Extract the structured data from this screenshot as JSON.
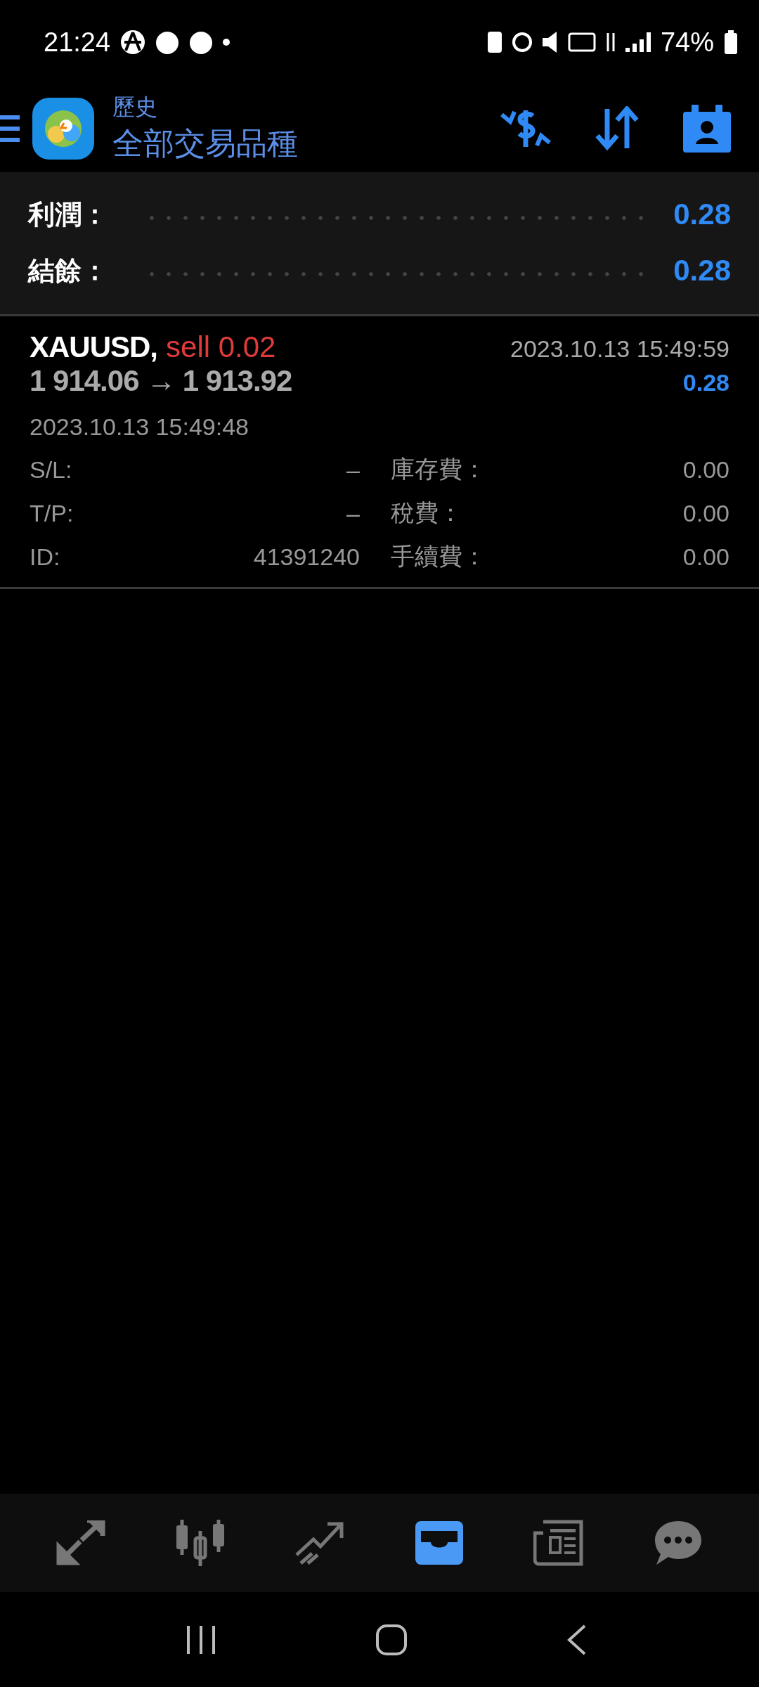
{
  "status_bar": {
    "time": "21:24",
    "battery": "74%"
  },
  "header": {
    "subtitle": "歷史",
    "title": "全部交易品種"
  },
  "summary": [
    {
      "label": "利潤：",
      "value": "0.28"
    },
    {
      "label": "結餘：",
      "value": "0.28"
    }
  ],
  "trade": {
    "symbol": "XAUUSD,",
    "side": "sell 0.02",
    "prices": "1 914.06 → 1 913.92",
    "close_time": "2023.10.13 15:49:59",
    "profit": "0.28",
    "open_time": "2023.10.13 15:49:48",
    "details": [
      {
        "label": "S/L:",
        "value": "–",
        "fee_label": "庫存費：",
        "fee_value": "0.00"
      },
      {
        "label": "T/P:",
        "value": "–",
        "fee_label": "稅費：",
        "fee_value": "0.00"
      },
      {
        "label": "ID:",
        "value": "41391240",
        "fee_label": "手續費：",
        "fee_value": "0.00"
      }
    ]
  },
  "bottom_nav": [
    {
      "kind": "quotes",
      "selected": false
    },
    {
      "kind": "chart",
      "selected": false
    },
    {
      "kind": "trade",
      "selected": false
    },
    {
      "kind": "history",
      "selected": true
    },
    {
      "kind": "news",
      "selected": false
    },
    {
      "kind": "chat",
      "selected": false
    }
  ]
}
